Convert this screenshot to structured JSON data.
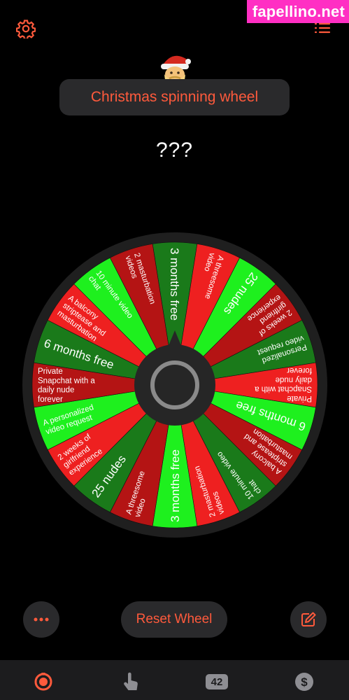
{
  "watermark": "fapellino.net",
  "header": {
    "title": "Christmas spinning wheel",
    "result": "???",
    "settings_icon": "gear-icon",
    "list_icon": "list-icon",
    "avatar_icon": "santa-emoji"
  },
  "wheel": {
    "colors": {
      "dark_green": "#1a7a1a",
      "bright_green": "#1ef01e",
      "dark_red": "#b41414",
      "bright_red": "#ee2020",
      "rim": "#1f1f1f",
      "hub": "#262626",
      "hub_ring": "#8a8a8a"
    },
    "segments": [
      {
        "label": "3 months free",
        "color": "dark_green"
      },
      {
        "label": "A threesome video",
        "color": "bright_red"
      },
      {
        "label": "25 nudes",
        "color": "bright_green"
      },
      {
        "label": "2 weeks of girlfriend experience",
        "color": "dark_red"
      },
      {
        "label": "Personalized video request",
        "color": "dark_green"
      },
      {
        "label": "Private Snapchat with a daily nude forever",
        "color": "bright_red"
      },
      {
        "label": "6 months free",
        "color": "bright_green"
      },
      {
        "label": "A balcony striptease and masturbation",
        "color": "dark_red"
      },
      {
        "label": "10 minute video chat",
        "color": "dark_green"
      },
      {
        "label": "2 masturbation videos",
        "color": "bright_red"
      },
      {
        "label": "3 months free",
        "color": "bright_green"
      },
      {
        "label": "A threesome video",
        "color": "dark_red"
      },
      {
        "label": "25 nudes",
        "color": "dark_green"
      },
      {
        "label": "2 weeks of girlfriend experience",
        "color": "bright_red"
      },
      {
        "label": "A personalized video request",
        "color": "bright_green"
      },
      {
        "label": "Private Snapchat with a daily nude forever",
        "color": "dark_red"
      },
      {
        "label": "6 months free",
        "color": "dark_green"
      },
      {
        "label": "A balcony striptease and masturbation",
        "color": "bright_red"
      },
      {
        "label": "10 minute video chat",
        "color": "bright_green"
      },
      {
        "label": "2 masturbation videos",
        "color": "dark_red"
      }
    ]
  },
  "controls": {
    "more_icon": "ellipsis-icon",
    "reset_label": "Reset Wheel",
    "edit_icon": "edit-icon"
  },
  "tabbar": {
    "tabs": [
      {
        "icon": "wheel-icon",
        "active": true
      },
      {
        "icon": "tap-icon",
        "active": false
      },
      {
        "icon": "number-icon",
        "badge": "42",
        "active": false
      },
      {
        "icon": "dollar-icon",
        "active": false
      }
    ],
    "accent": "#ff5a3c",
    "inactive": "#8e8e93"
  }
}
